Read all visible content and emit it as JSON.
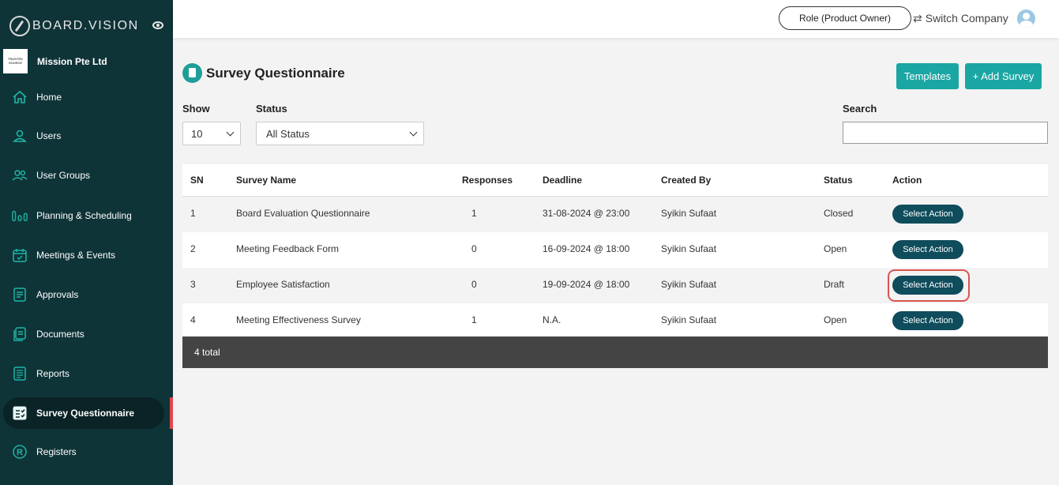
{
  "brand": {
    "name": "BOARD.VISION"
  },
  "company": {
    "logo_text": "TRUSTED SOURCE",
    "name": "Mission Pte Ltd"
  },
  "sidebar": {
    "items": [
      {
        "label": "Home",
        "icon": "home-icon"
      },
      {
        "label": "Users",
        "icon": "user-icon"
      },
      {
        "label": "User Groups",
        "icon": "user-group-icon"
      },
      {
        "label": "Planning & Scheduling",
        "icon": "chart-bars-icon"
      },
      {
        "label": "Meetings & Events",
        "icon": "calendar-icon"
      },
      {
        "label": "Approvals",
        "icon": "approval-doc-icon"
      },
      {
        "label": "Documents",
        "icon": "documents-icon"
      },
      {
        "label": "Reports",
        "icon": "report-icon"
      },
      {
        "label": "Survey Questionnaire",
        "icon": "survey-icon",
        "active": true
      },
      {
        "label": "Registers",
        "icon": "registered-icon"
      }
    ]
  },
  "topbar": {
    "role_label": "Role (Product Owner)",
    "switch_label": "Switch Company"
  },
  "page": {
    "title": "Survey Questionnaire",
    "templates_label": "Templates",
    "add_label": "+ Add Survey"
  },
  "filters": {
    "show_label": "Show",
    "show_value": "10",
    "status_label": "Status",
    "status_value": "All Status",
    "search_label": "Search",
    "search_value": ""
  },
  "table": {
    "headers": [
      "SN",
      "Survey Name",
      "Responses",
      "Deadline",
      "Created By",
      "Status",
      "Action"
    ],
    "rows": [
      {
        "sn": "1",
        "name": "Board Evaluation Questionnaire",
        "responses": "1",
        "deadline": "31-08-2024 @ 23:00",
        "created_by": "Syikin Sufaat",
        "status": "Closed",
        "action": "Select Action"
      },
      {
        "sn": "2",
        "name": "Meeting Feedback Form",
        "responses": "0",
        "deadline": "16-09-2024 @ 18:00",
        "created_by": "Syikin Sufaat",
        "status": "Open",
        "action": "Select Action"
      },
      {
        "sn": "3",
        "name": "Employee Satisfaction",
        "responses": "0",
        "deadline": "19-09-2024 @ 18:00",
        "created_by": "Syikin Sufaat",
        "status": "Draft",
        "action": "Select Action",
        "highlighted": true
      },
      {
        "sn": "4",
        "name": "Meeting Effectiveness Survey",
        "responses": "1",
        "deadline": "N.A.",
        "created_by": "Syikin Sufaat",
        "status": "Open",
        "action": "Select Action"
      }
    ],
    "footer": "4 total"
  },
  "colors": {
    "sidebar_bg": "#0f3438",
    "accent_teal": "#1aa6a3",
    "action_btn": "#0f4c5c",
    "active_bar": "#e2474c",
    "highlight": "#d9534f",
    "footer_bg": "#444444"
  }
}
